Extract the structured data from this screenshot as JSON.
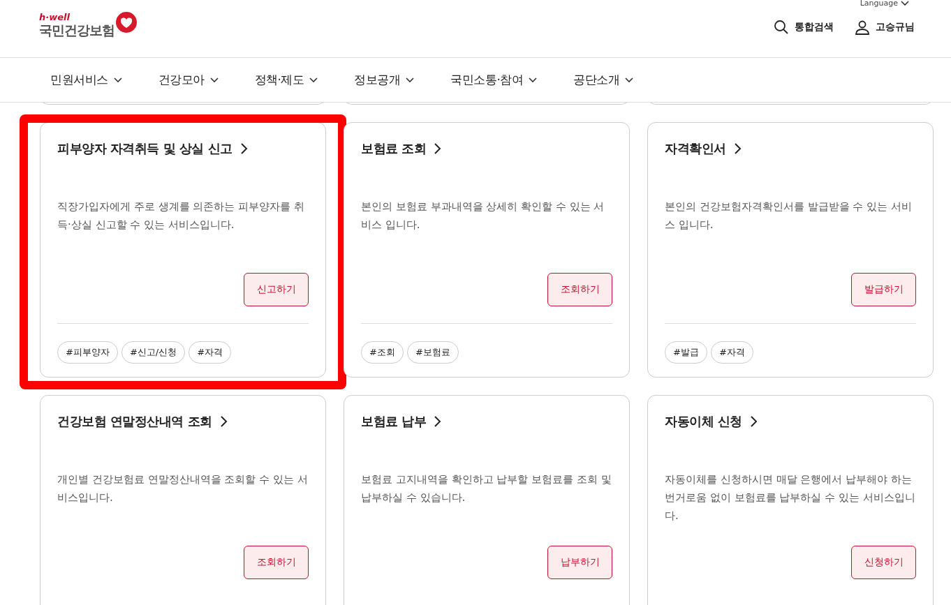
{
  "header": {
    "logo_tagline": "h·well",
    "logo_name": "국민건강보험",
    "utility": [
      {
        "label": "Language"
      }
    ],
    "actions": [
      {
        "kind": "search",
        "label": "통합검색"
      },
      {
        "kind": "user",
        "label": "고승규님"
      }
    ]
  },
  "nav": [
    {
      "label": "민원서비스"
    },
    {
      "label": "건강모아"
    },
    {
      "label": "정책·제도"
    },
    {
      "label": "정보공개"
    },
    {
      "label": "국민소통·참여"
    },
    {
      "label": "공단소개"
    }
  ],
  "cards": [
    {
      "title": "피부양자 자격취득 및 상실 신고",
      "description": "직장가입자에게 주로 생계를 의존하는 피부양자를 취득·상실 신고할 수 있는 서비스입니다.",
      "button": "신고하기",
      "tags": [
        "#피부양자",
        "#신고/신청",
        "#자격"
      ],
      "highlighted": true
    },
    {
      "title": "보험료 조회",
      "description": "본인의 보험료 부과내역을 상세히 확인할 수 있는 서비스 입니다.",
      "button": "조회하기",
      "tags": [
        "#조회",
        "#보험료"
      ],
      "highlighted": false
    },
    {
      "title": "자격확인서",
      "description": "본인의 건강보험자격확인서를 발급받을 수 있는 서비스 입니다.",
      "button": "발급하기",
      "tags": [
        "#발급",
        "#자격"
      ],
      "highlighted": false
    },
    {
      "title": "건강보험 연말정산내역 조회",
      "description": "개인별 건강보험료 연말정산내역을 조회할 수 있는 서비스입니다.",
      "button": "조회하기",
      "highlighted": false
    },
    {
      "title": "보험료 납부",
      "description": "보험료 고지내역을 확인하고 납부할 보험료를 조회 및 납부하실 수 있습니다.",
      "button": "납부하기",
      "highlighted": false
    },
    {
      "title": "자동이체 신청",
      "description": "자동이체를 신청하시면 매달 은행에서 납부해야 하는 번거로움 없이 보험료를 납부하실 수 있는 서비스입니다.",
      "button": "신청하기",
      "highlighted": false
    }
  ]
}
